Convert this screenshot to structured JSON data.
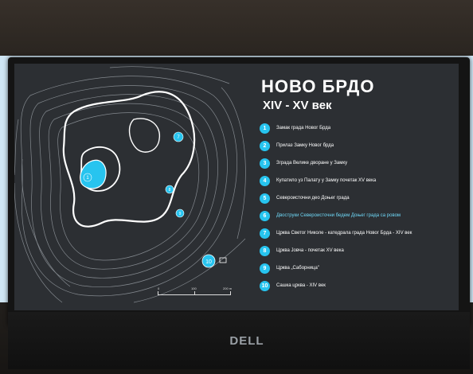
{
  "header": {
    "title": "НОВО БРДО",
    "subtitle": "XIV - XV век"
  },
  "legend": [
    {
      "num": "1",
      "label": "Замак града Новог Брда",
      "color": "#27c4ef"
    },
    {
      "num": "2",
      "label": "Прилаз Замку Новог брда",
      "color": "#27c4ef"
    },
    {
      "num": "3",
      "label": "Зграда Велике дворане у Замку",
      "color": "#27c4ef"
    },
    {
      "num": "4",
      "label": "Купатило уз Палату у Замку почетак XV века",
      "color": "#27c4ef"
    },
    {
      "num": "5",
      "label": "Североисточни део Доњег града",
      "color": "#27c4ef"
    },
    {
      "num": "6",
      "label": "Двоструки Североисточни бедем Доњег града са ровом",
      "color": "#27c4ef",
      "highlight": true
    },
    {
      "num": "7",
      "label": "Црква Светог Николе - катедрала града Новог Брда - XIV век",
      "color": "#27c4ef"
    },
    {
      "num": "8",
      "label": "Црква Јовча - почетак XV века",
      "color": "#27c4ef"
    },
    {
      "num": "9",
      "label": "Црква „Саборница\"",
      "color": "#27c4ef"
    },
    {
      "num": "10",
      "label": "Сашка црква - XIV век",
      "color": "#27c4ef"
    }
  ],
  "map_markers": [
    {
      "num": "1"
    },
    {
      "num": "7"
    },
    {
      "num": "8"
    },
    {
      "num": "9"
    },
    {
      "num": "10"
    }
  ],
  "scale": {
    "labels": [
      "0",
      "100",
      "200 m"
    ]
  },
  "brand": "DELL",
  "colors": {
    "accent": "#27c4ef",
    "screen_bg": "#2c2f33",
    "contour": "#9aa0a6"
  }
}
